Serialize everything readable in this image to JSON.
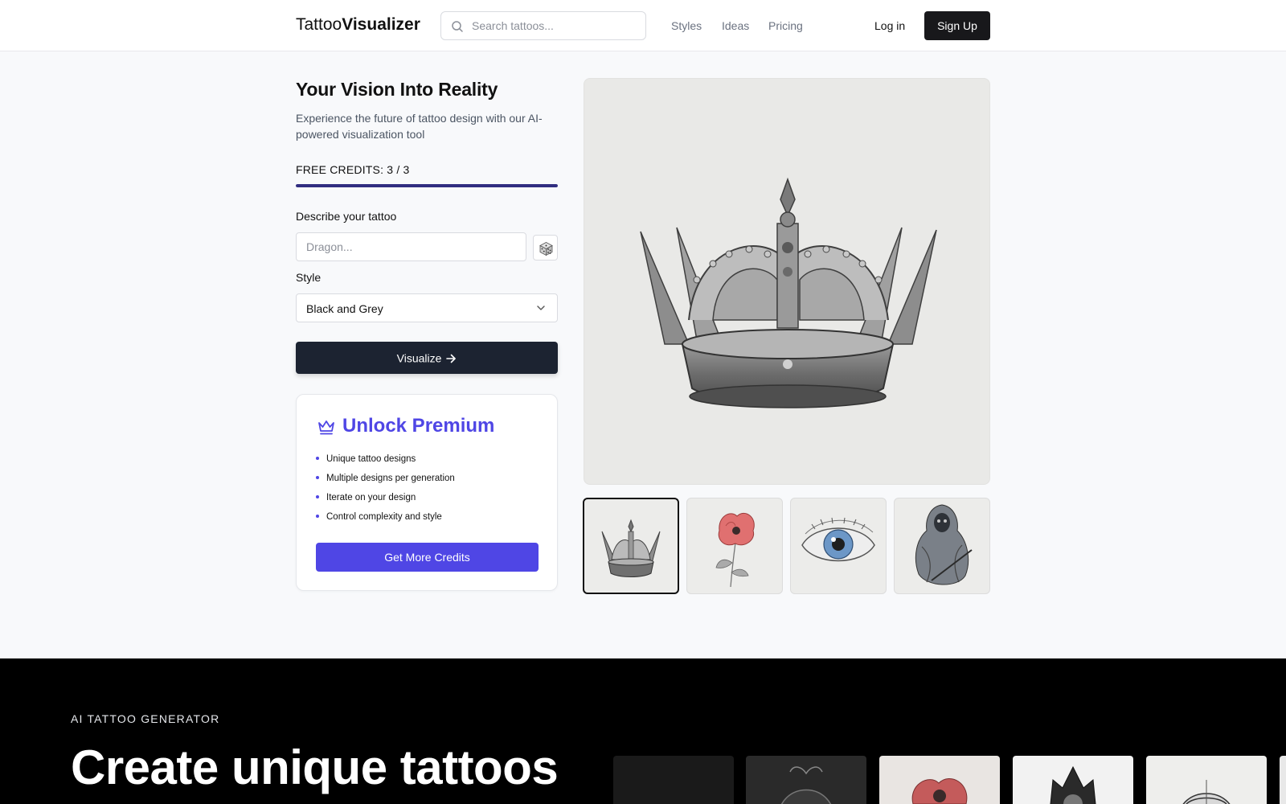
{
  "header": {
    "logo_regular": "Tattoo",
    "logo_bold": "Visualizer",
    "search_placeholder": "Search tattoos...",
    "nav": [
      "Styles",
      "Ideas",
      "Pricing"
    ],
    "login": "Log in",
    "signup": "Sign Up"
  },
  "form": {
    "title": "Your Vision Into Reality",
    "subtitle": "Experience the future of tattoo design with our AI-powered visualization tool",
    "credits": "FREE CREDITS: 3 / 3",
    "credits_used": 3,
    "credits_total": 3,
    "describe_label": "Describe your tattoo",
    "describe_placeholder": "Dragon...",
    "style_label": "Style",
    "style_value": "Black and Grey",
    "visualize_label": "Visualize"
  },
  "premium": {
    "title": "Unlock Premium",
    "features": [
      "Unique tattoo designs",
      "Multiple designs per generation",
      "Iterate on your design",
      "Control complexity and style"
    ],
    "cta": "Get More Credits"
  },
  "preview": {
    "thumbnails": [
      "crown-thumbnail",
      "poppy-thumbnail",
      "eye-thumbnail",
      "reaper-thumbnail"
    ],
    "active_thumbnail": 0
  },
  "section2": {
    "eyebrow": "AI TATTOO GENERATOR",
    "headline": "Create unique tattoos"
  },
  "colors": {
    "accent": "#4f46e5",
    "progress": "#312e81",
    "primary_button": "#1c2331"
  }
}
